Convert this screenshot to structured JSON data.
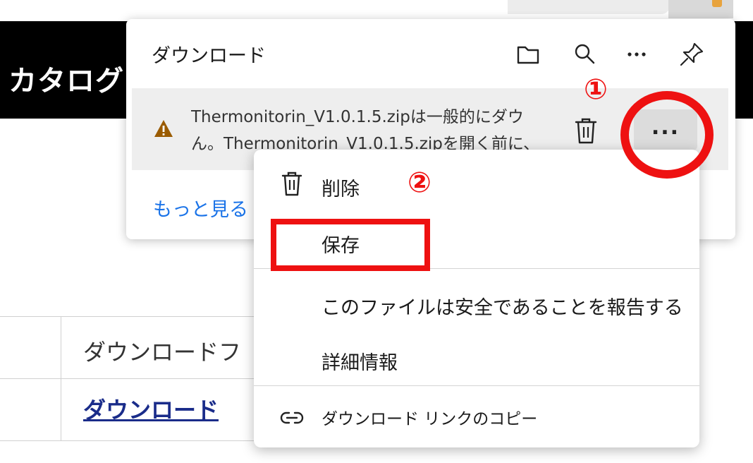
{
  "background": {
    "header_title": "カタログ",
    "table_cell_1": "ダウンロードフ",
    "table_cell_2": "ダウンロード"
  },
  "downloads_panel": {
    "title": "ダウンロード",
    "toolbar_icons": [
      "folder-icon",
      "search-icon",
      "more-icon",
      "pin-icon"
    ],
    "item": {
      "warning_line_1": "Thermonitorin_V1.0.1.5.zipは一般的にダウ",
      "warning_line_2": "ん。Thermonitorin_V1.0.1.5.zipを開く前に、",
      "more_label": "..."
    },
    "see_more": "もっと見る"
  },
  "context_menu": {
    "delete": "削除",
    "keep": "保存",
    "report_safe": "このファイルは安全であることを報告する",
    "details": "詳細情報",
    "copy_link": "ダウンロード リンクのコピー"
  },
  "annotations": {
    "step1": "①",
    "step2": "②",
    "highlight_color": "#ee1111"
  },
  "colors": {
    "link": "#1a73e8",
    "warning": "#9a5b00"
  }
}
